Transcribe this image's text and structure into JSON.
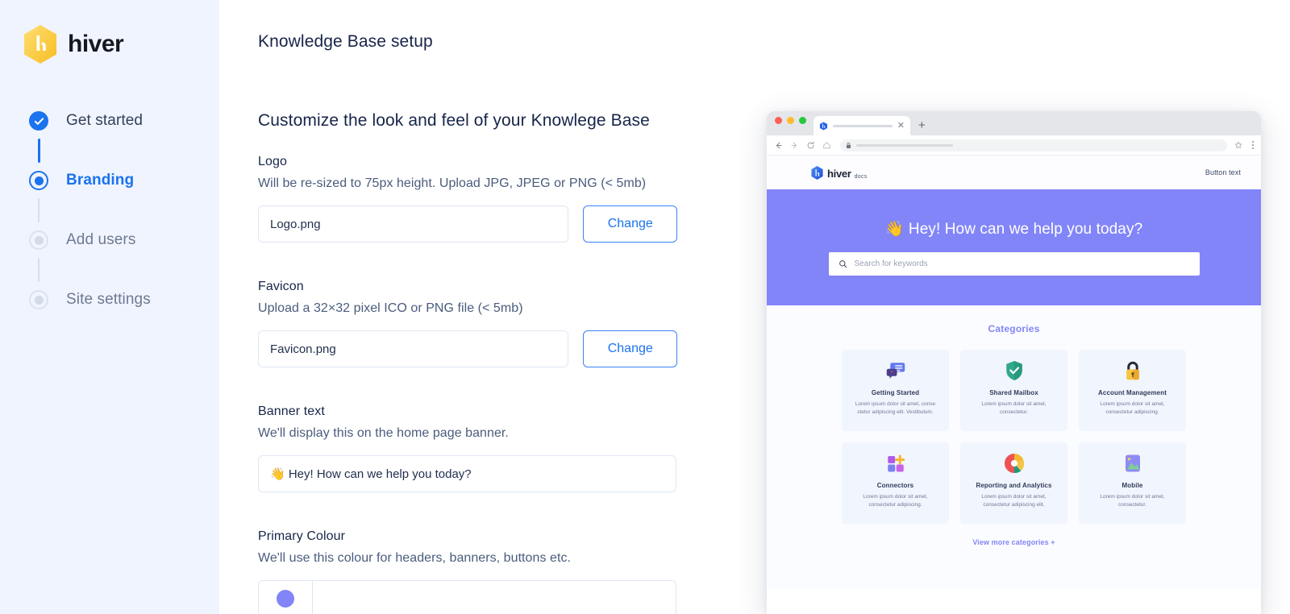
{
  "brand": {
    "word": "hiver",
    "logo_colors": {
      "hex_light": "#FFD75E",
      "hex_dark": "#F9C232"
    }
  },
  "sidebar": {
    "steps": [
      {
        "label": "Get started",
        "state": "done",
        "bullet_icon": "check-circle-icon"
      },
      {
        "label": "Branding",
        "state": "current",
        "bullet_icon": "radio-selected-icon"
      },
      {
        "label": "Add users",
        "state": "todo",
        "bullet_icon": "radio-empty-icon"
      },
      {
        "label": "Site settings",
        "state": "todo",
        "bullet_icon": "radio-empty-icon"
      }
    ]
  },
  "main": {
    "page_title": "Knowledge Base setup",
    "section_title": "Customize the look and feel of your Knowlege Base",
    "fields": {
      "logo": {
        "label": "Logo",
        "help": "Will be re-sized to 75px height. Upload JPG, JPEG or PNG (< 5mb)",
        "value": "Logo.png",
        "button": "Change"
      },
      "favicon": {
        "label": "Favicon",
        "help": "Upload a 32×32 pixel ICO or PNG file (< 5mb)",
        "value": "Favicon.png",
        "button": "Change"
      },
      "banner_text": {
        "label": "Banner text",
        "help": "We'll display this on the home page banner.",
        "value": "👋 Hey! How can we help you today?"
      },
      "primary_colour": {
        "label": "Primary Colour",
        "help": "We'll use this colour for headers, banners, buttons etc.",
        "value": "",
        "swatch_hex": "#8285F8"
      }
    }
  },
  "preview": {
    "browser": {
      "tab_close_icon": "close-icon",
      "new_tab_icon": "plus-icon",
      "back_icon": "arrow-left-icon",
      "forward_icon": "arrow-right-icon",
      "reload_icon": "reload-icon",
      "home_icon": "home-icon",
      "lock_icon": "lock-icon",
      "bookmark_icon": "star-icon",
      "menu_icon": "kebab-menu-icon"
    },
    "site": {
      "logo_word": "hiver",
      "logo_sub": "docs",
      "header_button": "Button text",
      "hero_title": "👋 Hey! How can we help you today?",
      "search_placeholder": "Search for keywords",
      "search_icon": "search-icon",
      "banner_hex": "#8285F8",
      "categories_heading": "Categories",
      "categories": [
        {
          "name": "Getting Started",
          "desc": "Lorem ipsum dolor sit amet, conse ctetur adipiscing elit. Vestibulum.",
          "icon": "chat-bubbles-icon"
        },
        {
          "name": "Shared Mailbox",
          "desc": "Lorem ipsum dolor sit amet, consectetur.",
          "icon": "shield-check-icon"
        },
        {
          "name": "Account Management",
          "desc": "Lorem ipsum dolor sit amet, consectetur adipiscing.",
          "icon": "padlock-icon"
        },
        {
          "name": "Connectors",
          "desc": "Lorem ipsum dolor sit amet, consectetur adipiscing.",
          "icon": "blocks-plus-icon"
        },
        {
          "name": "Reporting and Analytics",
          "desc": "Lorem ipsum dolor sit amet, consectetur adipiscing elit.",
          "icon": "pie-chart-icon"
        },
        {
          "name": "Mobile",
          "desc": "Lorem ipsum dolor sit amet, consectetur.",
          "icon": "image-icon"
        }
      ],
      "view_more": "View more categories +"
    }
  }
}
